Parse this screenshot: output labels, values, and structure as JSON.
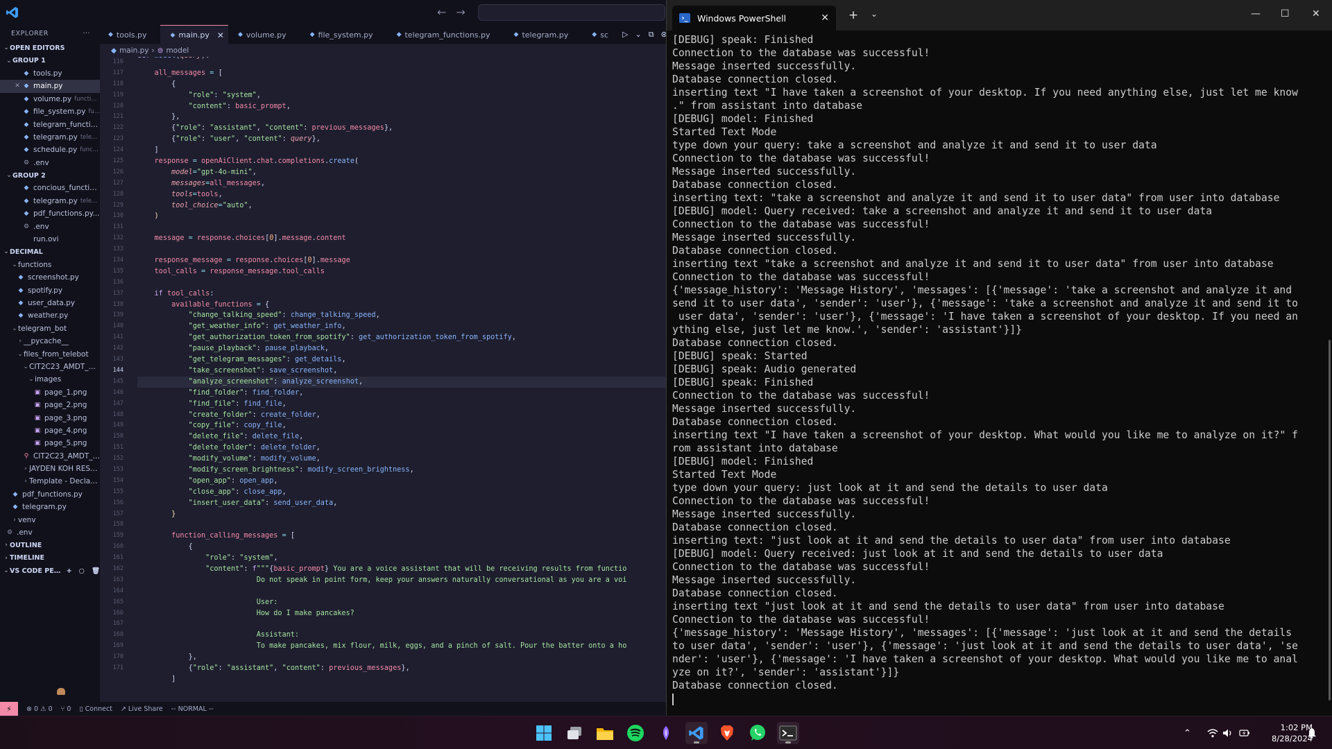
{
  "vscode": {
    "explorer_label": "EXPLORER",
    "more_label": "···",
    "open_editors_label": "OPEN EDITORS",
    "group1_label": "GROUP 1",
    "group1_files": [
      {
        "name": "tools.py",
        "hint": ""
      },
      {
        "name": "main.py",
        "hint": ""
      },
      {
        "name": "volume.py",
        "hint": "functi..."
      },
      {
        "name": "file_system.py",
        "hint": "fu..."
      },
      {
        "name": "telegram_functio...",
        "hint": ""
      },
      {
        "name": "telegram.py",
        "hint": "tele..."
      },
      {
        "name": "schedule.py",
        "hint": "func..."
      },
      {
        "name": ".env",
        "hint": ""
      }
    ],
    "group2_label": "GROUP 2",
    "group2_files": [
      {
        "name": "concious_functio...",
        "hint": ""
      },
      {
        "name": "telegram.py",
        "hint": "tele..."
      },
      {
        "name": "pdf_functions.py...",
        "hint": ""
      },
      {
        "name": ".env",
        "hint": ""
      },
      {
        "name": "run.ovi",
        "hint": ""
      }
    ],
    "workspace_label": "DECIMAL",
    "tree": [
      "functions",
      "screenshot.py",
      "spotify.py",
      "user_data.py",
      "weather.py",
      "telegram_bot",
      "__pycache__",
      "files_from_telebot",
      "CIT2C23_AMDT_AY...",
      "images",
      "page_1.png",
      "page_2.png",
      "page_3.png",
      "page_4.png",
      "page_5.png",
      "CIT2C23_AMDT_A...",
      "JAYDEN KOH RESU...",
      "Template - Declara...",
      "pdf_functions.py",
      "telegram.py",
      "venv",
      ".env"
    ],
    "outline_label": "OUTLINE",
    "timeline_label": "TIMELINE",
    "pets_label": "VS CODE PETS",
    "tabs": [
      {
        "label": "tools.py"
      },
      {
        "label": "main.py"
      },
      {
        "label": "volume.py"
      },
      {
        "label": "file_system.py"
      },
      {
        "label": "telegram_functions.py"
      },
      {
        "label": "telegram.py"
      },
      {
        "label": "sc"
      }
    ],
    "breadcrumb": {
      "file": "main.py",
      "symbol": "model"
    },
    "signature": "def model(query):",
    "line_numbers": [
      "116",
      "117",
      "118",
      "119",
      "120",
      "121",
      "122",
      "123",
      "124",
      "125",
      "126",
      "127",
      "128",
      "129",
      "130",
      "131",
      "132",
      "133",
      "134",
      "135",
      "136",
      "137",
      "138",
      "139",
      "140",
      "141",
      "142",
      "143",
      "144",
      "145",
      "146",
      "147",
      "148",
      "149",
      "150",
      "151",
      "152",
      "153",
      "154",
      "155",
      "156",
      "157",
      "158",
      "159",
      "160",
      "161",
      "162",
      "163",
      "164",
      "165",
      "166",
      "167",
      "168",
      "169",
      "170",
      "171"
    ],
    "status": {
      "problems": "⊗ 0 ⚠ 0",
      "ports": "⑂ 0",
      "connect": "Connect",
      "live_share": "Live Share",
      "mode": "-- NORMAL --"
    }
  },
  "terminal": {
    "title": "Windows PowerShell",
    "lines": [
      "[DEBUG] speak: Finished",
      "Connection to the database was successful!",
      "Message inserted successfully.",
      "Database connection closed.",
      "inserting text \"I have taken a screenshot of your desktop. If you need anything else, just let me know",
      ".\" from assistant into database",
      "[DEBUG] model: Finished",
      "Started Text Mode",
      "type down your query: take a screenshot and analyze it and send it to user data",
      "Connection to the database was successful!",
      "Message inserted successfully.",
      "Database connection closed.",
      "inserting text: \"take a screenshot and analyze it and send it to user data\" from user into database",
      "[DEBUG] model: Query received: take a screenshot and analyze it and send it to user data",
      "Connection to the database was successful!",
      "Message inserted successfully.",
      "Database connection closed.",
      "inserting text \"take a screenshot and analyze it and send it to user data\" from user into database",
      "Connection to the database was successful!",
      "{'message_history': 'Message History', 'messages': [{'message': 'take a screenshot and analyze it and",
      "send it to user data', 'sender': 'user'}, {'message': 'take a screenshot and analyze it and send it to",
      " user data', 'sender': 'user'}, {'message': 'I have taken a screenshot of your desktop. If you need an",
      "ything else, just let me know.', 'sender': 'assistant'}]}",
      "Database connection closed.",
      "[DEBUG] speak: Started",
      "[DEBUG] speak: Audio generated",
      "[DEBUG] speak: Finished",
      "Connection to the database was successful!",
      "Message inserted successfully.",
      "Database connection closed.",
      "inserting text \"I have taken a screenshot of your desktop. What would you like me to analyze on it?\" f",
      "rom assistant into database",
      "[DEBUG] model: Finished",
      "Started Text Mode",
      "type down your query: just look at it and send the details to user data",
      "Connection to the database was successful!",
      "Message inserted successfully.",
      "Database connection closed.",
      "inserting text: \"just look at it and send the details to user data\" from user into database",
      "[DEBUG] model: Query received: just look at it and send the details to user data",
      "Connection to the database was successful!",
      "Message inserted successfully.",
      "Database connection closed.",
      "inserting text \"just look at it and send the details to user data\" from user into database",
      "Connection to the database was successful!",
      "{'message_history': 'Message History', 'messages': [{'message': 'just look at it and send the details",
      "to user data', 'sender': 'user'}, {'message': 'just look at it and send the details to user data', 'se",
      "nder': 'user'}, {'message': 'I have taken a screenshot of your desktop. What would you like me to anal",
      "yze on it?', 'sender': 'assistant'}]}",
      "Database connection closed."
    ]
  },
  "taskbar": {
    "apps": [
      "start-icon",
      "task-view-icon",
      "file-explorer-icon",
      "spotify-icon",
      "copilot-icon",
      "vscode-icon",
      "brave-icon",
      "whatsapp-icon",
      "terminal-icon"
    ],
    "time": "1:02 PM",
    "date": "8/28/2024"
  },
  "colors": {
    "editor_bg": "#1e1e2e",
    "sidebar_bg": "#11111b",
    "terminal_bg": "#0c0c0c",
    "accent": "#f38ba8"
  }
}
